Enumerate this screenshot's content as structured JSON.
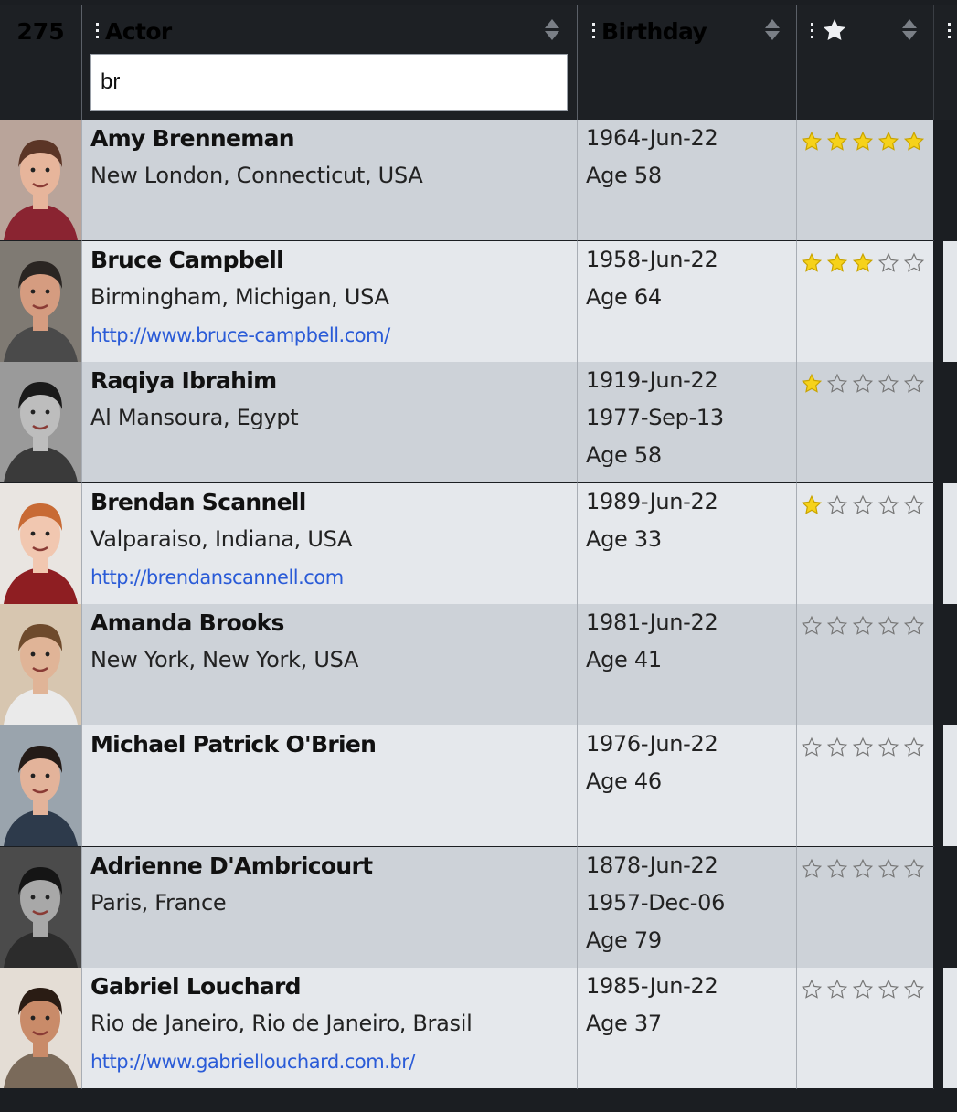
{
  "header": {
    "count": "275",
    "actor_label": "Actor",
    "birthday_label": "Birthday",
    "rating_icon": "star-icon",
    "filter_value": "br"
  },
  "colors": {
    "header_bg": "#1d2024",
    "row_odd": "#cdd2d8",
    "row_even": "#e5e8ec",
    "link": "#2a5bd7",
    "star_filled": "#f6d21a"
  },
  "rows": [
    {
      "name": "Amy Brenneman",
      "place": "New London, Connecticut, USA",
      "url": "",
      "birthday": "1964-Jun-22",
      "deathday": "",
      "age": "Age 58",
      "rating": 5
    },
    {
      "name": "Bruce Campbell",
      "place": "Birmingham, Michigan, USA",
      "url": "http://www.bruce-campbell.com/",
      "birthday": "1958-Jun-22",
      "deathday": "",
      "age": "Age 64",
      "rating": 3
    },
    {
      "name": "Raqiya Ibrahim",
      "place": "Al Mansoura, Egypt",
      "url": "",
      "birthday": "1919-Jun-22",
      "deathday": "1977-Sep-13",
      "age": "Age 58",
      "rating": 1
    },
    {
      "name": "Brendan Scannell",
      "place": "Valparaiso, Indiana, USA",
      "url": "http://brendanscannell.com",
      "birthday": "1989-Jun-22",
      "deathday": "",
      "age": "Age 33",
      "rating": 1
    },
    {
      "name": "Amanda Brooks",
      "place": "New York, New York, USA",
      "url": "",
      "birthday": "1981-Jun-22",
      "deathday": "",
      "age": "Age 41",
      "rating": 0
    },
    {
      "name": "Michael Patrick O'Brien",
      "place": "",
      "url": "",
      "birthday": "1976-Jun-22",
      "deathday": "",
      "age": "Age 46",
      "rating": 0
    },
    {
      "name": "Adrienne D'Ambricourt",
      "place": "Paris, France",
      "url": "",
      "birthday": "1878-Jun-22",
      "deathday": "1957-Dec-06",
      "age": "Age 79",
      "rating": 0
    },
    {
      "name": "Gabriel Louchard",
      "place": "Rio de Janeiro, Rio de Janeiro, Brasil",
      "url": "http://www.gabriellouchard.com.br/",
      "birthday": "1985-Jun-22",
      "deathday": "",
      "age": "Age 37",
      "rating": 0
    }
  ]
}
